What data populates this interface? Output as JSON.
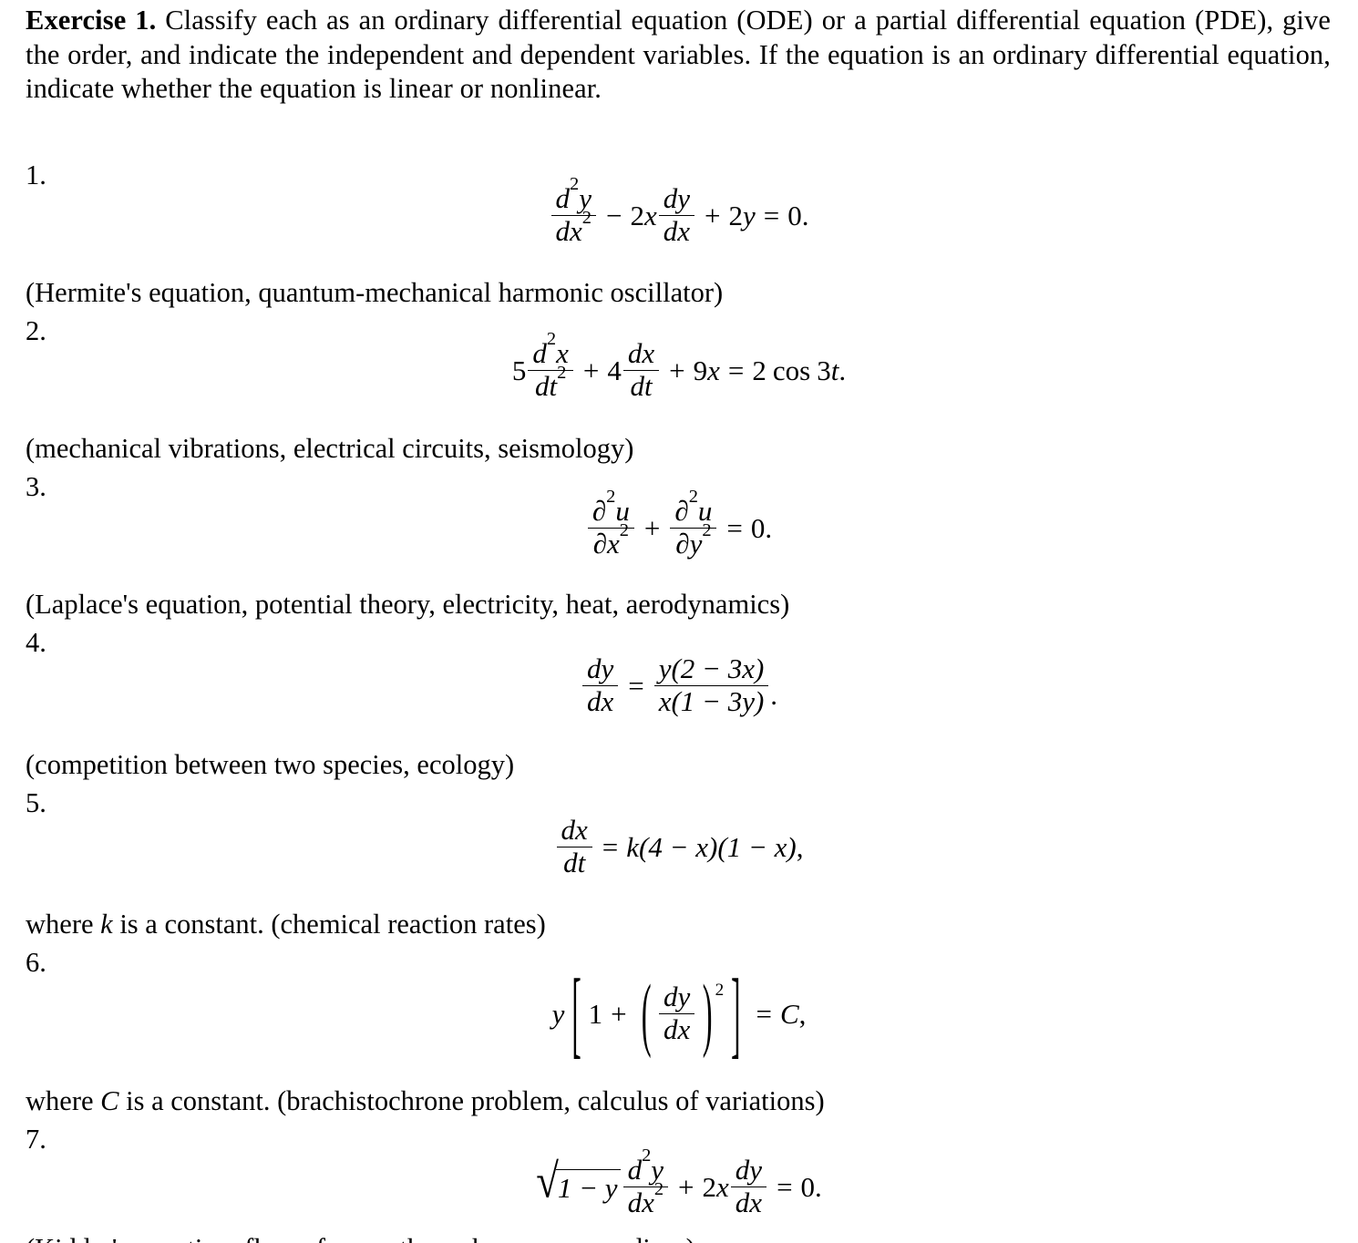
{
  "document": {
    "exercise_label": "Exercise 1.",
    "instructions": " Classify each as an ordinary differential equation (ODE) or a partial differential equation (PDE), give the order, and indicate the independent and dependent variables. If the equation is an ordinary differential equation, indicate whether the equation is linear or nonlinear.",
    "items": [
      {
        "number": "1.",
        "equation_text": "d²y/dx² − 2x dy/dx + 2y = 0.",
        "caption": "(Hermite's equation, quantum-mechanical harmonic oscillator)",
        "parts": {
          "frac1_numer_d": "d",
          "frac1_numer_sup": "2",
          "frac1_numer_var": "y",
          "frac1_denom_d": "d",
          "frac1_denom_var": "x",
          "frac1_denom_sup": "2",
          "minus": "−",
          "coef1": "2",
          "coefvar1": "x",
          "frac2_numer_d": "d",
          "frac2_numer_var": "y",
          "frac2_denom_d": "d",
          "frac2_denom_var": "x",
          "plus": "+",
          "coef2": "2",
          "coefvar2": "y",
          "equals": "=",
          "rhs": "0",
          "period": "."
        }
      },
      {
        "number": "2.",
        "equation_text": "5 d²x/dt² + 4 dx/dt + 9x = 2 cos 3t.",
        "caption": "(mechanical vibrations, electrical circuits, seismology)",
        "parts": {
          "coef_a": "5",
          "frac1_numer_d": "d",
          "frac1_numer_sup": "2",
          "frac1_numer_var": "x",
          "frac1_denom_d": "d",
          "frac1_denom_var": "t",
          "frac1_denom_sup": "2",
          "plus1": "+",
          "coef_b": "4",
          "frac2_numer_d": "d",
          "frac2_numer_var": "x",
          "frac2_denom_d": "d",
          "frac2_denom_var": "t",
          "plus2": "+",
          "coef_c": "9",
          "var_c": "x",
          "equals": "=",
          "rhs_coef": "2",
          "rhs_fn": "cos",
          "rhs_arg_num": "3",
          "rhs_arg_var": "t",
          "period": "."
        }
      },
      {
        "number": "3.",
        "equation_text": "∂²u/∂x² + ∂²u/∂y² = 0.",
        "caption": "(Laplace's equation, potential theory, electricity, heat, aerodynamics)",
        "parts": {
          "frac1_numer_d": "∂",
          "frac1_numer_sup": "2",
          "frac1_numer_var": "u",
          "frac1_denom_d": "∂",
          "frac1_denom_var": "x",
          "frac1_denom_sup": "2",
          "plus": "+",
          "frac2_numer_d": "∂",
          "frac2_numer_sup": "2",
          "frac2_numer_var": "u",
          "frac2_denom_d": "∂",
          "frac2_denom_var": "y",
          "frac2_denom_sup": "2",
          "equals": "=",
          "rhs": "0",
          "period": "."
        }
      },
      {
        "number": "4.",
        "equation_text": "dy/dx = y(2 − 3x) / x(1 − 3y).",
        "caption": "(competition between two species, ecology)",
        "parts": {
          "lhs_numer_d": "d",
          "lhs_numer_var": "y",
          "lhs_denom_d": "d",
          "lhs_denom_var": "x",
          "equals": "=",
          "rhs_numer": "y(2 − 3x)",
          "rhs_denom": "x(1 − 3y)",
          "period": "."
        }
      },
      {
        "number": "5.",
        "equation_text": "dx/dt = k(4 − x)(1 − x),",
        "caption_prefix": "where ",
        "caption_var": "k",
        "caption_suffix": " is a constant.  (chemical reaction rates)",
        "parts": {
          "lhs_numer_d": "d",
          "lhs_numer_var": "x",
          "lhs_denom_d": "d",
          "lhs_denom_var": "t",
          "equals": "=",
          "rhs_k": "k",
          "rhs_group1": "(4 − x)",
          "rhs_group2": "(1 − x)",
          "comma": ","
        }
      },
      {
        "number": "6.",
        "equation_text": "y[1 + (dy/dx)²] = C,",
        "caption_prefix": "where ",
        "caption_var": "C",
        "caption_suffix": " is a constant.  (brachistochrone problem, calculus of variations)",
        "parts": {
          "lead_var": "y",
          "lbrack": "[",
          "one": "1",
          "plus": "+",
          "lparen": "(",
          "frac_numer_d": "d",
          "frac_numer_var": "y",
          "frac_denom_d": "d",
          "frac_denom_var": "x",
          "rparen": ")",
          "exponent": "2",
          "rbrack": "]",
          "equals": "=",
          "rhs": "C",
          "comma": ","
        }
      },
      {
        "number": "7.",
        "equation_text": "√(1 − y) d²y/dx² + 2x dy/dx = 0.",
        "caption": "(Kidder's equation, flow of gases through a porous medium)",
        "parts": {
          "radical": "√",
          "radicand": "1 − y",
          "frac1_numer_d": "d",
          "frac1_numer_sup": "2",
          "frac1_numer_var": "y",
          "frac1_denom_d": "d",
          "frac1_denom_var": "x",
          "frac1_denom_sup": "2",
          "plus": "+",
          "coef": "2",
          "coefvar": "x",
          "frac2_numer_d": "d",
          "frac2_numer_var": "y",
          "frac2_denom_d": "d",
          "frac2_denom_var": "x",
          "equals": "=",
          "rhs": "0",
          "period": "."
        }
      }
    ]
  }
}
